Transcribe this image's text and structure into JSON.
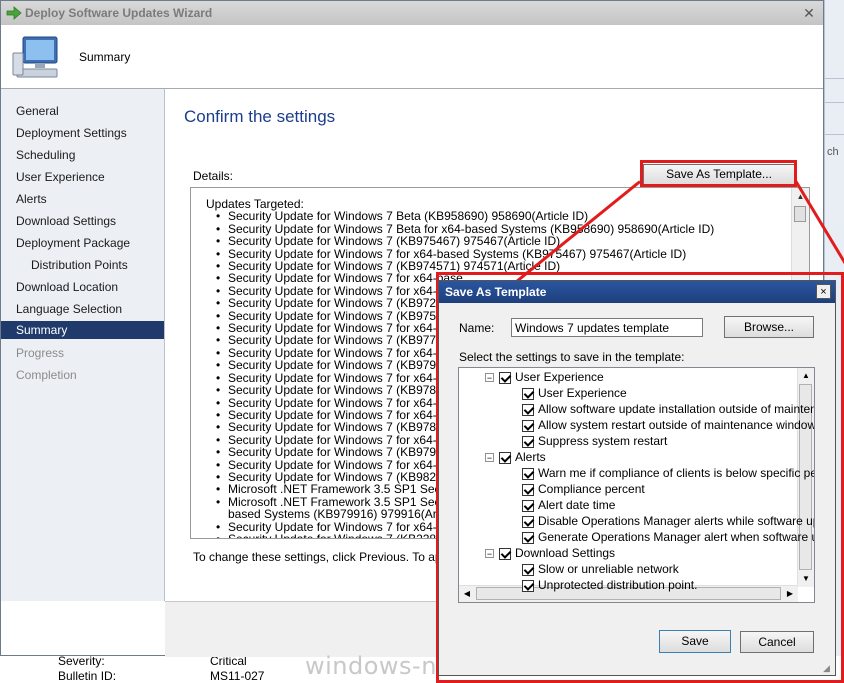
{
  "background": {
    "severity_label": "Severity:",
    "severity_value": "Critical",
    "bulletin_label": "Bulletin ID:",
    "bulletin_value": "MS11-027",
    "partial_text": "ch",
    "watermark": "windows-noob.com"
  },
  "wizard": {
    "title": "Deploy Software Updates Wizard",
    "header_title": "Summary",
    "nav": [
      {
        "label": "General",
        "state": "normal"
      },
      {
        "label": "Deployment Settings",
        "state": "normal"
      },
      {
        "label": "Scheduling",
        "state": "normal"
      },
      {
        "label": "User Experience",
        "state": "normal"
      },
      {
        "label": "Alerts",
        "state": "normal"
      },
      {
        "label": "Download Settings",
        "state": "normal"
      },
      {
        "label": "Deployment Package",
        "state": "normal"
      },
      {
        "label": "Distribution Points",
        "state": "normal"
      },
      {
        "label": "Download Location",
        "state": "normal"
      },
      {
        "label": "Language Selection",
        "state": "normal"
      },
      {
        "label": "Summary",
        "state": "active"
      },
      {
        "label": "Progress",
        "state": "disabled"
      },
      {
        "label": "Completion",
        "state": "disabled"
      }
    ],
    "confirm_title": "Confirm the settings",
    "details_label": "Details:",
    "save_as_template_button": "Save As Template...",
    "updates_heading": "Updates Targeted:",
    "updates": [
      "Security Update for Windows 7 Beta (KB958690) 958690(Article ID)",
      "Security Update for Windows 7 Beta for x64-based Systems (KB958690) 958690(Article ID)",
      "Security Update for Windows 7 (KB975467) 975467(Article ID)",
      "Security Update for Windows 7 for x64-based Systems (KB975467) 975467(Article ID)",
      "Security Update for Windows 7 (KB974571) 974571(Article ID)",
      "Security Update for Windows 7 for x64-base",
      "Security Update for Windows 7 for x64-base",
      "Security Update for Windows 7 (KB972270",
      "Security Update for Windows 7 (KB975560",
      "Security Update for Windows 7 for x64-base",
      "Security Update for Windows 7 (KB977165",
      "Security Update for Windows 7 for x64-base",
      "Security Update for Windows 7 (KB979309",
      "Security Update for Windows 7 for x64-base",
      "Security Update for Windows 7 (KB978601",
      "Security Update for Windows 7 for x64-base",
      "Security Update for Windows 7 for x64-base",
      "Security Update for Windows 7 (KB978542",
      "Security Update for Windows 7 for x64-base",
      "Security Update for Windows 7 (KB979482",
      "Security Update for Windows 7 for x64-base",
      "Security Update for Windows 7 (KB982666",
      "Microsoft .NET Framework 3.5 SP1 Securit",
      "Microsoft .NET Framework 3.5 SP1 Securit"
    ],
    "updates_continuation": "based Systems (KB979916) 979916(Article",
    "updates_tail": [
      "Security Update for Windows 7 for x64-bas",
      "Security Update for Windows 7 (KB228619"
    ],
    "footer_note": "To change these settings, click Previous. To apply t"
  },
  "dialog": {
    "title": "Save As Template",
    "close_glyph": "×",
    "name_label": "Name:",
    "name_value": "Windows 7 updates template",
    "browse_button": "Browse...",
    "select_label": "Select the settings to save in the template:",
    "tree": [
      {
        "level": 0,
        "label": "User Experience",
        "checked": true,
        "expander": "−"
      },
      {
        "level": 1,
        "label": "User Experience",
        "checked": true
      },
      {
        "level": 1,
        "label": "Allow software update installation outside of maintenanc",
        "checked": true
      },
      {
        "level": 1,
        "label": "Allow system restart outside of maintenance windows",
        "checked": true
      },
      {
        "level": 1,
        "label": "Suppress system restart",
        "checked": true
      },
      {
        "level": 0,
        "label": "Alerts",
        "checked": true,
        "expander": "−"
      },
      {
        "level": 1,
        "label": "Warn me if compliance of clients is below specific perce",
        "checked": true
      },
      {
        "level": 1,
        "label": "Compliance percent",
        "checked": true
      },
      {
        "level": 1,
        "label": "Alert date time",
        "checked": true
      },
      {
        "level": 1,
        "label": "Disable Operations Manager alerts while software updat",
        "checked": true
      },
      {
        "level": 1,
        "label": "Generate Operations Manager alert when software upda",
        "checked": true
      },
      {
        "level": 0,
        "label": "Download Settings",
        "checked": true,
        "expander": "−"
      },
      {
        "level": 1,
        "label": "Slow or unreliable network",
        "checked": true
      },
      {
        "level": 1,
        "label": "Unprotected distribution point.",
        "checked": true
      }
    ],
    "save_button": "Save",
    "cancel_button": "Cancel"
  },
  "colors": {
    "annotation_red": "#e21c1c",
    "nav_active": "#1f3a6b",
    "title_blue": "#1b3d8c",
    "dialog_titlebar": "#1e3f7c"
  }
}
